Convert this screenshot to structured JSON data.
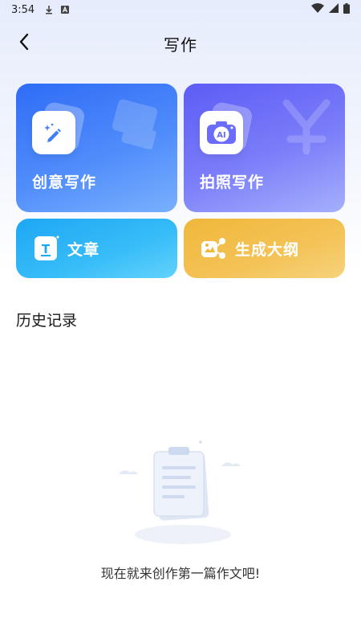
{
  "status_bar": {
    "time": "3:54",
    "icons": [
      "download-icon",
      "a-box-icon",
      "wifi-icon",
      "signal-icon",
      "battery-icon"
    ]
  },
  "header": {
    "title": "写作",
    "back_icon": "chevron-left-icon"
  },
  "cards": {
    "creative": {
      "label": "创意写作",
      "icon": "pen-sparkle-icon",
      "color": "#2f6cf6"
    },
    "photo": {
      "label": "拍照写作",
      "icon": "ai-camera-icon",
      "icon_text": "AI",
      "color": "#5d5cf6"
    },
    "article": {
      "label": "文章",
      "icon": "text-document-icon",
      "icon_text": "T",
      "color": "#1ea7f4"
    },
    "outline": {
      "label": "生成大纲",
      "icon": "mindmap-icon",
      "color": "#f0b73a"
    }
  },
  "history": {
    "title": "历史记录",
    "empty_text": "现在就来创作第一篇作文吧!"
  }
}
